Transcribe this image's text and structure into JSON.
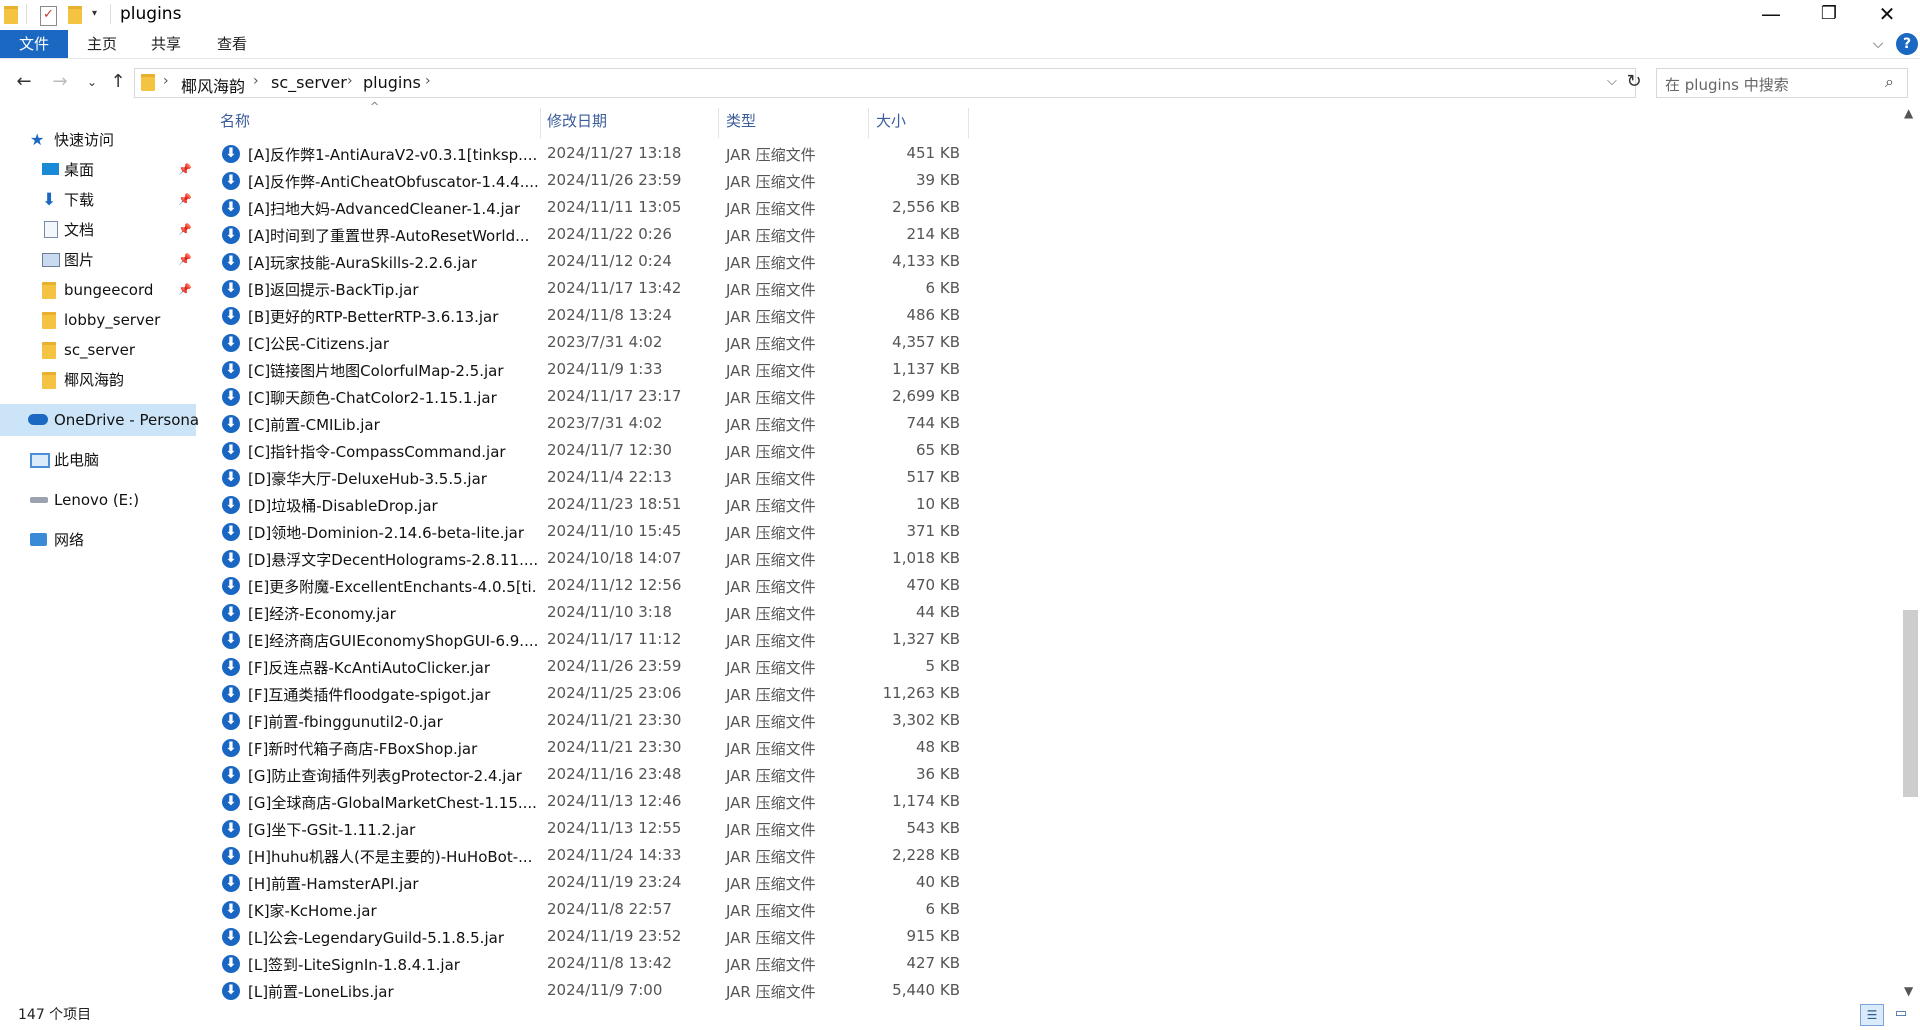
{
  "window": {
    "title": "plugins",
    "minimize_glyph": "—",
    "restore_glyph": "❐",
    "close_glyph": "✕"
  },
  "ribbon": {
    "tabs": [
      "文件",
      "主页",
      "共享",
      "查看"
    ]
  },
  "address": {
    "breadcrumbs": [
      "椰风海韵",
      "sc_server",
      "plugins"
    ],
    "search_placeholder": "在 plugins 中搜索"
  },
  "sidebar": {
    "items": [
      {
        "label": "快速访问",
        "icon": "star-icon"
      },
      {
        "label": "桌面",
        "icon": "desktop-icon",
        "pinned": true
      },
      {
        "label": "下载",
        "icon": "download-icon",
        "pinned": true
      },
      {
        "label": "文档",
        "icon": "document-icon",
        "pinned": true
      },
      {
        "label": "图片",
        "icon": "picture-icon",
        "pinned": true
      },
      {
        "label": "bungeecord",
        "icon": "folder-icon",
        "pinned": true
      },
      {
        "label": "lobby_server",
        "icon": "folder-icon"
      },
      {
        "label": "sc_server",
        "icon": "folder-icon"
      },
      {
        "label": "椰风海韵",
        "icon": "folder-icon"
      },
      {
        "label": "OneDrive - Persona",
        "icon": "cloud-icon"
      },
      {
        "label": "此电脑",
        "icon": "computer-icon"
      },
      {
        "label": "Lenovo (E:)",
        "icon": "drive-icon"
      },
      {
        "label": "网络",
        "icon": "network-icon"
      }
    ]
  },
  "columns": {
    "name": "名称",
    "date": "修改日期",
    "type": "类型",
    "size": "大小"
  },
  "files": [
    {
      "name": "[A]反作弊1-AntiAuraV2-v0.3.1[tinksp....",
      "date": "2024/11/27 13:18",
      "type": "JAR 压缩文件",
      "size": "451 KB"
    },
    {
      "name": "[A]反作弊-AntiCheatObfuscator-1.4.4....",
      "date": "2024/11/26 23:59",
      "type": "JAR 压缩文件",
      "size": "39 KB"
    },
    {
      "name": "[A]扫地大妈-AdvancedCleaner-1.4.jar",
      "date": "2024/11/11 13:05",
      "type": "JAR 压缩文件",
      "size": "2,556 KB"
    },
    {
      "name": "[A]时间到了重置世界-AutoResetWorld...",
      "date": "2024/11/22 0:26",
      "type": "JAR 压缩文件",
      "size": "214 KB"
    },
    {
      "name": "[A]玩家技能-AuraSkills-2.2.6.jar",
      "date": "2024/11/12 0:24",
      "type": "JAR 压缩文件",
      "size": "4,133 KB"
    },
    {
      "name": "[B]返回提示-BackTip.jar",
      "date": "2024/11/17 13:42",
      "type": "JAR 压缩文件",
      "size": "6 KB"
    },
    {
      "name": "[B]更好的RTP-BetterRTP-3.6.13.jar",
      "date": "2024/11/8 13:24",
      "type": "JAR 压缩文件",
      "size": "486 KB"
    },
    {
      "name": "[C]公民-Citizens.jar",
      "date": "2023/7/31 4:02",
      "type": "JAR 压缩文件",
      "size": "4,357 KB"
    },
    {
      "name": "[C]链接图片地图ColorfulMap-2.5.jar",
      "date": "2024/11/9 1:33",
      "type": "JAR 压缩文件",
      "size": "1,137 KB"
    },
    {
      "name": "[C]聊天颜色-ChatColor2-1.15.1.jar",
      "date": "2024/11/17 23:17",
      "type": "JAR 压缩文件",
      "size": "2,699 KB"
    },
    {
      "name": "[C]前置-CMILib.jar",
      "date": "2023/7/31 4:02",
      "type": "JAR 压缩文件",
      "size": "744 KB"
    },
    {
      "name": "[C]指针指令-CompassCommand.jar",
      "date": "2024/11/7 12:30",
      "type": "JAR 压缩文件",
      "size": "65 KB"
    },
    {
      "name": "[D]豪华大厅-DeluxeHub-3.5.5.jar",
      "date": "2024/11/4 22:13",
      "type": "JAR 压缩文件",
      "size": "517 KB"
    },
    {
      "name": "[D]垃圾桶-DisableDrop.jar",
      "date": "2024/11/23 18:51",
      "type": "JAR 压缩文件",
      "size": "10 KB"
    },
    {
      "name": "[D]领地-Dominion-2.14.6-beta-lite.jar",
      "date": "2024/11/10 15:45",
      "type": "JAR 压缩文件",
      "size": "371 KB"
    },
    {
      "name": "[D]悬浮文字DecentHolograms-2.8.11....",
      "date": "2024/10/18 14:07",
      "type": "JAR 压缩文件",
      "size": "1,018 KB"
    },
    {
      "name": "[E]更多附魔-ExcellentEnchants-4.0.5[ti...",
      "date": "2024/11/12 12:56",
      "type": "JAR 压缩文件",
      "size": "470 KB"
    },
    {
      "name": "[E]经济-Economy.jar",
      "date": "2024/11/10 3:18",
      "type": "JAR 压缩文件",
      "size": "44 KB"
    },
    {
      "name": "[E]经济商店GUIEconomyShopGUI-6.9....",
      "date": "2024/11/17 11:12",
      "type": "JAR 压缩文件",
      "size": "1,327 KB"
    },
    {
      "name": "[F]反连点器-KcAntiAutoClicker.jar",
      "date": "2024/11/26 23:59",
      "type": "JAR 压缩文件",
      "size": "5 KB"
    },
    {
      "name": "[F]互通类插件floodgate-spigot.jar",
      "date": "2024/11/25 23:06",
      "type": "JAR 压缩文件",
      "size": "11,263 KB"
    },
    {
      "name": "[F]前置-fbinggunutil2-0.jar",
      "date": "2024/11/21 23:30",
      "type": "JAR 压缩文件",
      "size": "3,302 KB"
    },
    {
      "name": "[F]新时代箱子商店-FBoxShop.jar",
      "date": "2024/11/21 23:30",
      "type": "JAR 压缩文件",
      "size": "48 KB"
    },
    {
      "name": "[G]防止查询插件列表gProtector-2.4.jar",
      "date": "2024/11/16 23:48",
      "type": "JAR 压缩文件",
      "size": "36 KB"
    },
    {
      "name": "[G]全球商店-GlobalMarketChest-1.15....",
      "date": "2024/11/13 12:46",
      "type": "JAR 压缩文件",
      "size": "1,174 KB"
    },
    {
      "name": "[G]坐下-GSit-1.11.2.jar",
      "date": "2024/11/13 12:55",
      "type": "JAR 压缩文件",
      "size": "543 KB"
    },
    {
      "name": "[H]huhu机器人(不是主要的)-HuHoBot-...",
      "date": "2024/11/24 14:33",
      "type": "JAR 压缩文件",
      "size": "2,228 KB"
    },
    {
      "name": "[H]前置-HamsterAPI.jar",
      "date": "2024/11/19 23:24",
      "type": "JAR 压缩文件",
      "size": "40 KB"
    },
    {
      "name": "[K]家-KcHome.jar",
      "date": "2024/11/8 22:57",
      "type": "JAR 压缩文件",
      "size": "6 KB"
    },
    {
      "name": "[L]公会-LegendaryGuild-5.1.8.5.jar",
      "date": "2024/11/19 23:52",
      "type": "JAR 压缩文件",
      "size": "915 KB"
    },
    {
      "name": "[L]签到-LiteSignIn-1.8.4.1.jar",
      "date": "2024/11/8 13:42",
      "type": "JAR 压缩文件",
      "size": "427 KB"
    },
    {
      "name": "[L]前置-LoneLibs.jar",
      "date": "2024/11/9 7:00",
      "type": "JAR 压缩文件",
      "size": "5,440 KB"
    }
  ],
  "status": {
    "item_count": "147 个项目"
  },
  "colors": {
    "accent": "#1a68c1",
    "header_text": "#3b5c9a",
    "selected_bg": "#cce4f7"
  }
}
